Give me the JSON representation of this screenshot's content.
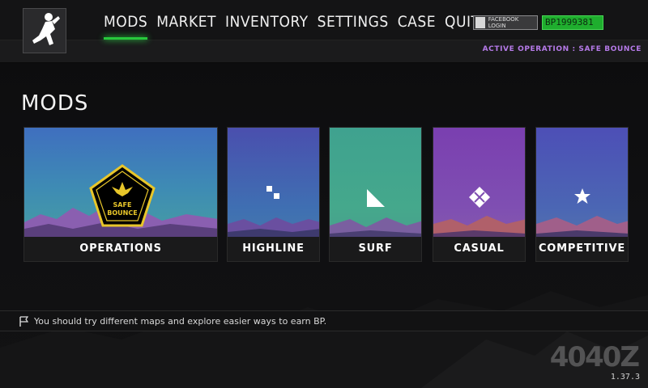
{
  "nav": {
    "items": [
      "MODS",
      "MARKET",
      "INVENTORY",
      "SETTINGS",
      "CASE",
      "QUIT"
    ],
    "active": "MODS"
  },
  "account": {
    "facebook_label": "FACEBOOK LOGIN",
    "bp": "BP1999381"
  },
  "operation": {
    "text": "ACTIVE OPERATION : SAFE BOUNCE"
  },
  "page": {
    "title": "MODS"
  },
  "cards": [
    {
      "label": "OPERATIONS",
      "badge_line1": "SAFE",
      "badge_line2": "BOUNCE"
    },
    {
      "label": "HIGHLINE"
    },
    {
      "label": "SURF"
    },
    {
      "label": "CASUAL"
    },
    {
      "label": "COMPETITIVE"
    }
  ],
  "hint": {
    "text": "You should try different maps and explore easier ways to earn BP."
  },
  "watermark": "4040Z",
  "version": "1.37.3",
  "colors": {
    "accent_green": "#27c93c",
    "operation_purple": "#b57ae8",
    "badge_gold": "#e8c62a"
  }
}
